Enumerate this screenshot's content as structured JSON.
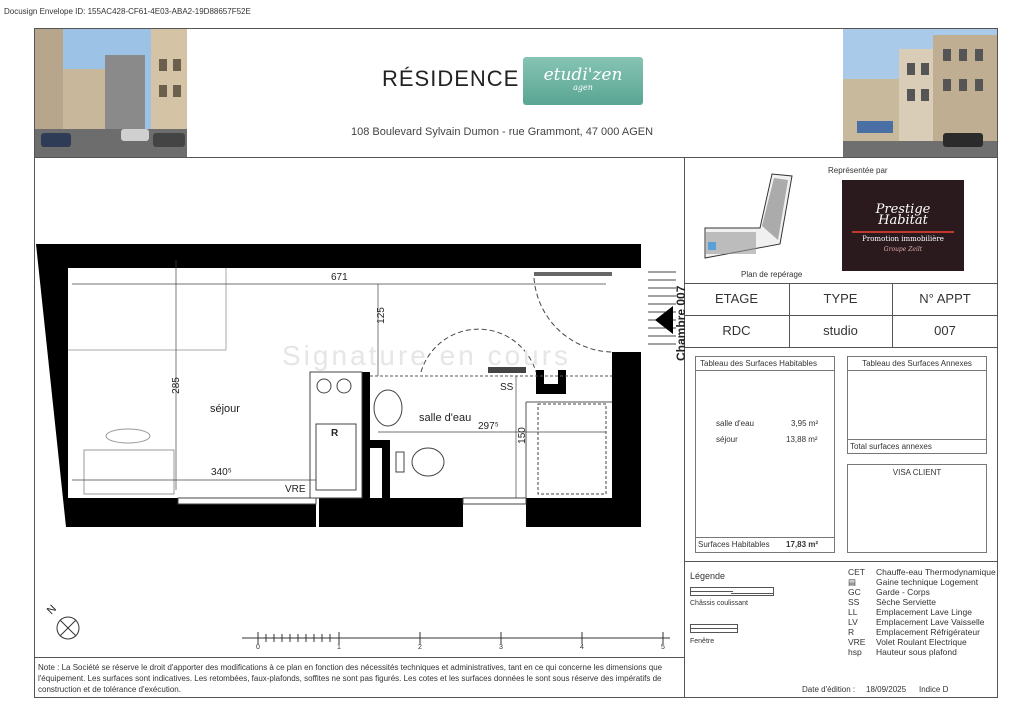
{
  "envelope_id": "Docusign Envelope ID: 155AC428-CF61-4E03-ABA2-19D88657F52E",
  "header": {
    "title": "RÉSIDENCE",
    "logo_main": "etudi'zen",
    "logo_sub": "agen",
    "address": "108 Boulevard Sylvain Dumon - rue Grammont, 47 000 AGEN"
  },
  "locator": {
    "caption": "Plan de repérage"
  },
  "representative": {
    "label": "Représentée par",
    "brand_line1": "Prestige",
    "brand_line2": "Habitat",
    "brand_tag": "Promotion immobilière",
    "brand_group": "Groupe Zeilt"
  },
  "unit_table": {
    "headers": [
      "ETAGE",
      "TYPE",
      "N° APPT"
    ],
    "values": [
      "RDC",
      "studio",
      "007"
    ]
  },
  "surfaces_habitables": {
    "title": "Tableau des Surfaces Habitables",
    "rows": [
      {
        "name": "salle d'eau",
        "value": "3,95 m²"
      },
      {
        "name": "séjour",
        "value": "13,88 m²"
      }
    ],
    "total_label": "Surfaces Habitables",
    "total_value": "17,83 m²"
  },
  "surfaces_annexes": {
    "title": "Tableau des Surfaces Annexes",
    "total_label": "Total surfaces annexes"
  },
  "visa": {
    "title": "VISA CLIENT"
  },
  "legend": {
    "title": "Légende",
    "chassis": "Châssis coulissant",
    "fenetre": "Fenêtre",
    "items": [
      {
        "code": "CET",
        "label": "Chauffe-eau Thermodynamique"
      },
      {
        "code": "",
        "label": "Gaine technique Logement"
      },
      {
        "code": "GC",
        "label": "Garde - Corps"
      },
      {
        "code": "SS",
        "label": "Sèche Serviette"
      },
      {
        "code": "LL",
        "label": "Emplacement Lave Linge"
      },
      {
        "code": "LV",
        "label": "Emplacement Lave Vaisselle"
      },
      {
        "code": "R",
        "label": "Emplacement Réfrigérateur"
      },
      {
        "code": "VRE",
        "label": "Volet Roulant Electrique"
      },
      {
        "code": "hsp",
        "label": "Hauteur sous plafond"
      }
    ]
  },
  "footer": {
    "date_label": "Date d'édition :",
    "date_value": "18/09/2025",
    "index": "Indice D"
  },
  "note": "Note : La Société se réserve le droit d'apporter des modifications à ce plan en fonction des nécessités techniques et administratives, tant en ce qui concerne les dimensions que l'équipement. Les surfaces sont indicatives. Les retombées, faux-plafonds, soffites ne sont pas figurés. Les cotes et les surfaces données le sont sous réserve des impératifs de construction et de tolérance d'exécution.",
  "plan": {
    "rooms": {
      "sejour": "séjour",
      "salle_deau": "salle d'eau"
    },
    "side_label": "Chambre 007",
    "watermark": "Signature en cours",
    "dims": {
      "d671": "671",
      "d125": "125",
      "d285": "285",
      "d3405": "340⁵",
      "d2975": "297⁵",
      "d150": "150"
    },
    "labels": {
      "ss": "SS",
      "vre": "VRE",
      "r": "R"
    },
    "north": "N",
    "scale_ticks": [
      "0",
      "1",
      "2",
      "3",
      "4",
      "5"
    ]
  }
}
